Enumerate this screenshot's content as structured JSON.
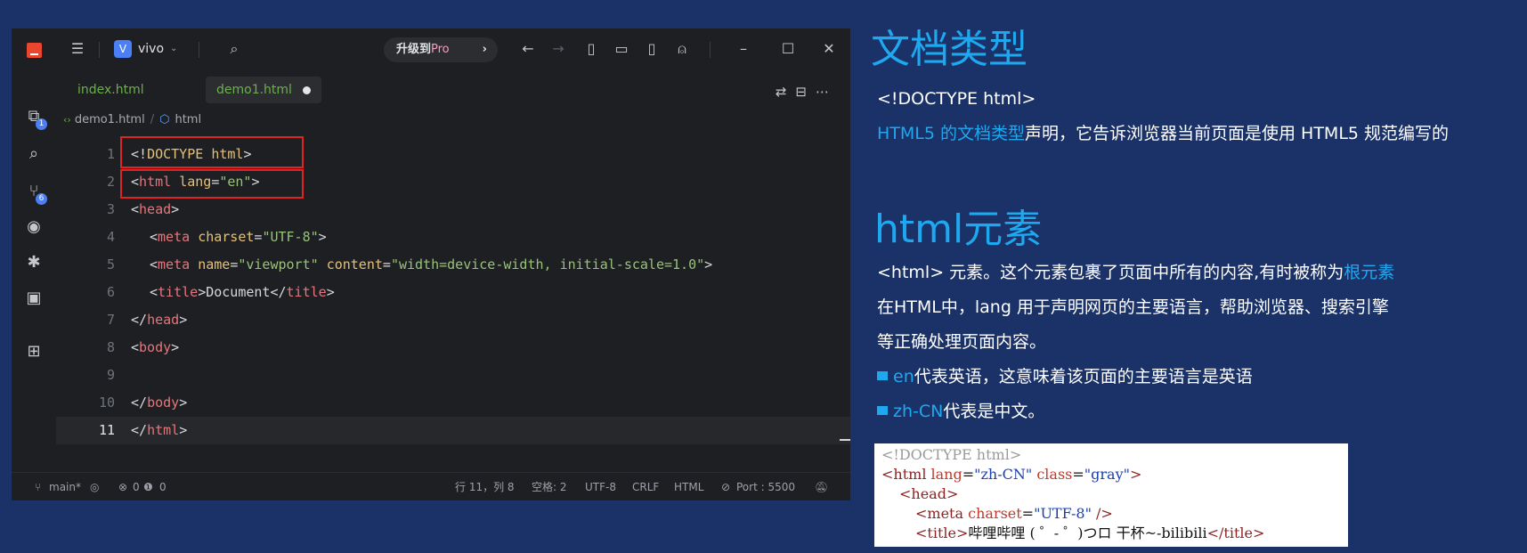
{
  "editor": {
    "workspace": {
      "badge": "V",
      "name": "vivo"
    },
    "upgrade": {
      "label": "升级到",
      "pro": "Pro",
      "arrow": "›"
    },
    "activity_badges": {
      "explorer": "1",
      "source_control": "6"
    },
    "tabs": [
      {
        "label": "index.html",
        "active": false
      },
      {
        "label": "demo1.html",
        "active": true,
        "modified": true
      }
    ],
    "breadcrumb": {
      "file": "demo1.html",
      "node": "html"
    },
    "line_numbers": [
      "1",
      "2",
      "3",
      "4",
      "5",
      "6",
      "7",
      "8",
      "9",
      "10",
      "11"
    ],
    "code": {
      "l1": {
        "open": "<!",
        "doctype": "DOCTYPE",
        "sp": " ",
        "html": "html",
        "close": ">"
      },
      "l2": {
        "lt": "<",
        "tag": "html",
        "sp": " ",
        "attr": "lang",
        "eq": "=",
        "val": "\"en\"",
        "gt": ">"
      },
      "l3": {
        "lt": "<",
        "tag": "head",
        "gt": ">"
      },
      "l4": {
        "lt": "<",
        "tag": "meta",
        "sp": " ",
        "attr": "charset",
        "eq": "=",
        "val": "\"UTF-8\"",
        "gt": ">"
      },
      "l5": {
        "lt": "<",
        "tag": "meta",
        "sp": " ",
        "attr1": "name",
        "eq1": "=",
        "val1": "\"viewport\"",
        "sp2": " ",
        "attr2": "content",
        "eq2": "=",
        "val2": "\"width=device-width, initial-scale=1.0\"",
        "gt": ">"
      },
      "l6": {
        "lt": "<",
        "tag": "title",
        "gt": ">",
        "text": "Document",
        "lt2": "</",
        "tag2": "title",
        "gt2": ">"
      },
      "l7": {
        "lt": "</",
        "tag": "head",
        "gt": ">"
      },
      "l8": {
        "lt": "<",
        "tag": "body",
        "gt": ">"
      },
      "l10": {
        "lt": "</",
        "tag": "body",
        "gt": ">"
      },
      "l11": {
        "lt": "</",
        "tag": "html",
        "gt": ">"
      }
    },
    "status": {
      "branch": "main*",
      "errors": "0",
      "warnings": "0",
      "position": "行 11，列 8",
      "spaces": "空格: 2",
      "encoding": "UTF-8",
      "eol": "CRLF",
      "language": "HTML",
      "port": "Port : 5500"
    }
  },
  "slide": {
    "heading1": "文档类型",
    "doctype_line": "<!DOCTYPE html>",
    "desc1_accent": "HTML5 的文档类型",
    "desc1_rest": "声明，它告诉浏览器当前页面是使用 HTML5 规范编写的",
    "heading2": "html元素",
    "p1_main": "<html> 元素。这个元素包裹了页面中所有的内容,有时被称为",
    "p1_accent": "根元素",
    "p2": "在HTML中，lang 用于声明网页的主要语言，帮助浏览器、搜索引擎",
    "p3": "等正确处理页面内容。",
    "b1_accent": "en",
    "b1_rest": "代表英语，这意味着该页面的主要语言是英语",
    "b2_accent": "zh-CN",
    "b2_rest": "代表是中文。",
    "snippet": {
      "l1": "<!DOCTYPE html>",
      "l2_open": "<html ",
      "l2_attr1": "lang",
      "l2_eq1": "=",
      "l2_val1": "\"zh-CN\"",
      "l2_sp": " ",
      "l2_attr2": "class",
      "l2_eq2": "=",
      "l2_val2": "\"gray\"",
      "l2_close": ">",
      "l3": "<head>",
      "l4_open": "<meta ",
      "l4_attr": "charset",
      "l4_eq": "=",
      "l4_val": "\"UTF-8\"",
      "l4_close": " />",
      "l5_open": "<title>",
      "l5_text": "哔哩哔哩 ( ゜- ゜)つロ 干杯~-bilibili",
      "l5_close": "</title>"
    }
  },
  "colors": {
    "accent": "#1ea8f0",
    "background": "#1b3268",
    "highlight_box": "#e02424"
  }
}
